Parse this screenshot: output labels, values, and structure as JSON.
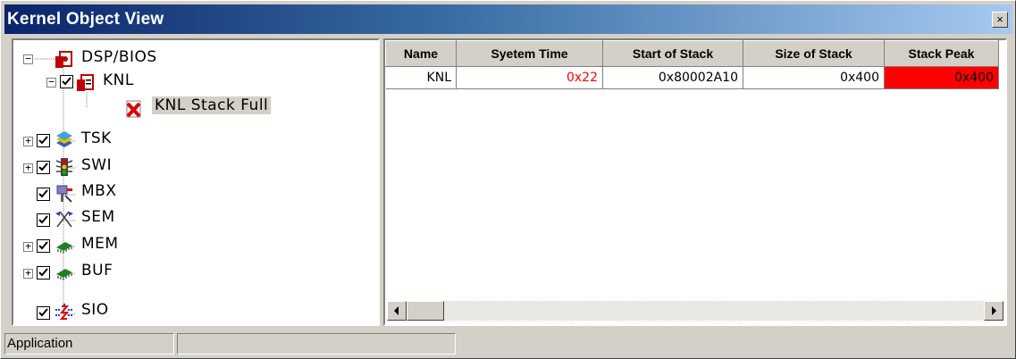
{
  "window": {
    "title": "Kernel Object View",
    "close_glyph": "×"
  },
  "tree": {
    "root": {
      "label": "DSP/BIOS",
      "expander": "−",
      "icon": "dsp-bios-icon"
    },
    "nodes": [
      {
        "key": "knl",
        "label": "KNL",
        "expander": "−",
        "checked": true,
        "icon": "knl-icon"
      },
      {
        "key": "knl-stack-full",
        "label": "KNL Stack Full",
        "icon": "error-x-icon",
        "selected": true
      },
      {
        "key": "tsk",
        "label": "TSK",
        "expander": "+",
        "checked": true,
        "icon": "tsk-icon"
      },
      {
        "key": "swi",
        "label": "SWI",
        "expander": "+",
        "checked": true,
        "icon": "swi-traffic-light-icon"
      },
      {
        "key": "mbx",
        "label": "MBX",
        "checked": true,
        "icon": "mbx-mailbox-icon"
      },
      {
        "key": "sem",
        "label": "SEM",
        "checked": true,
        "icon": "sem-flags-icon"
      },
      {
        "key": "mem",
        "label": "MEM",
        "expander": "+",
        "checked": true,
        "icon": "mem-chip-icon"
      },
      {
        "key": "buf",
        "label": "BUF",
        "expander": "+",
        "checked": true,
        "icon": "buf-chip-icon"
      },
      {
        "key": "sio",
        "label": "SIO",
        "checked": true,
        "icon": "sio-stream-icon"
      }
    ]
  },
  "grid": {
    "columns": [
      "Name",
      "Syetem Time",
      "Start of Stack",
      "Size of Stack",
      "Stack Peak"
    ],
    "rows": [
      [
        "KNL",
        "0x22",
        "0x80002A10",
        "0x400",
        "0x400"
      ]
    ],
    "colors": {
      "highlight_text": "#ff0000",
      "alert_bg": "#ff0000"
    }
  },
  "status": {
    "left": "Application",
    "middle": "",
    "right": ""
  },
  "colors": {
    "title_start": "#0a246a",
    "title_end": "#a6caf0",
    "face": "#d4d0c8"
  }
}
